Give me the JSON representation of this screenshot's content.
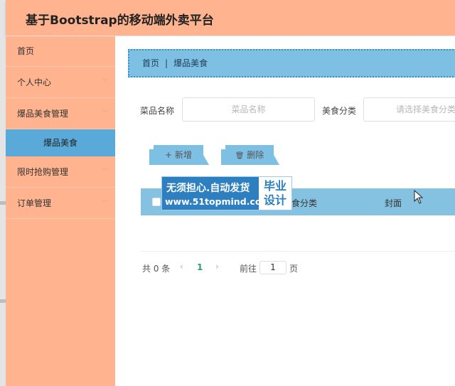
{
  "app": {
    "title": "基于Bootstrap的移动端外卖平台"
  },
  "sidebar": {
    "items": [
      {
        "label": "首页"
      },
      {
        "label": "个人中心"
      },
      {
        "label": "爆品美食管理"
      },
      {
        "label": "限时抢购管理"
      },
      {
        "label": "订单管理"
      }
    ],
    "sub_item": {
      "label": "爆品美食"
    }
  },
  "breadcrumb": {
    "home": "首页",
    "separator": "|",
    "current": "爆品美食"
  },
  "search": {
    "name_label": "菜品名称",
    "name_placeholder": "菜品名称",
    "category_label": "美食分类",
    "category_placeholder": "请选择美食分类"
  },
  "toolbar": {
    "add_label": "新增",
    "add_icon": "+",
    "delete_label": "删除",
    "delete_icon": "🗑"
  },
  "table": {
    "columns": [
      "食分类",
      "封面"
    ]
  },
  "watermark": {
    "main": "无须担心.自动发货",
    "url": "www.51topmind.com",
    "side_line1": "毕业",
    "side_line2": "设计"
  },
  "pagination": {
    "total_text": "共 0 条",
    "prev_icon": "‹",
    "current_page": "1",
    "next_icon": "›",
    "goto_label": "前往",
    "goto_value": "1",
    "page_suffix": "页"
  },
  "colors": {
    "header_bg": "#ffb48f",
    "sidebar_bg": "#ffb48f",
    "active_bg": "#59a9d9",
    "accent": "#7dc0e3"
  }
}
